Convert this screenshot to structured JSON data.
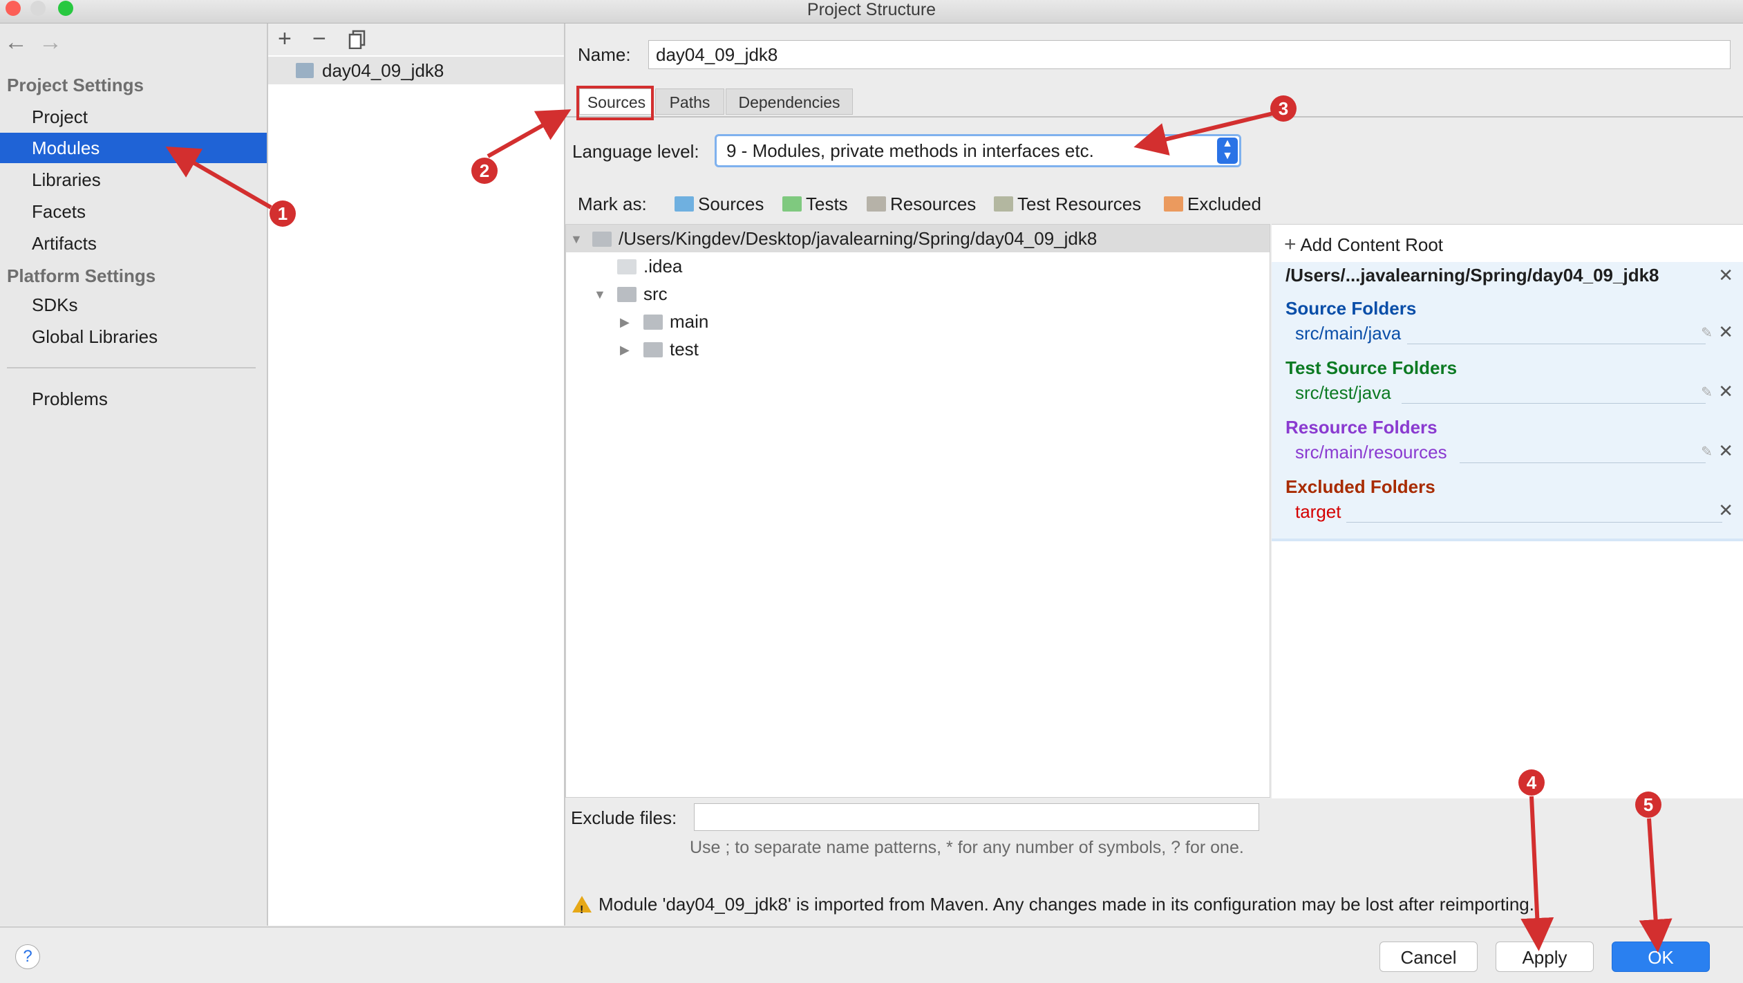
{
  "window": {
    "title": "Project Structure"
  },
  "colors": {
    "accent": "#1f63d6",
    "annotation": "#d32f2f",
    "source": "#0a4ea8",
    "test": "#0c7a23",
    "resource": "#8a3ad0",
    "excluded": "#a82b00",
    "excluded_path": "#d40000"
  },
  "nav": {
    "back_icon": "arrow-left-icon",
    "forward_icon": "arrow-right-icon"
  },
  "sidebar": {
    "project_settings_header": "Project Settings",
    "project_items": [
      "Project",
      "Modules",
      "Libraries",
      "Facets",
      "Artifacts"
    ],
    "selected": "Modules",
    "platform_settings_header": "Platform Settings",
    "platform_items": [
      "SDKs",
      "Global Libraries"
    ],
    "problems": "Problems"
  },
  "module_list": {
    "toolbar": {
      "add": "+",
      "remove": "−"
    },
    "modules": [
      "day04_09_jdk8"
    ]
  },
  "editor": {
    "name_label": "Name:",
    "name_value": "day04_09_jdk8",
    "tabs": [
      "Sources",
      "Paths",
      "Dependencies"
    ],
    "active_tab": "Sources",
    "language_level_label": "Language level:",
    "language_level_value": "9 - Modules, private methods in interfaces etc.",
    "mark_as_label": "Mark as:",
    "mark_as": [
      "Sources",
      "Tests",
      "Resources",
      "Test Resources",
      "Excluded"
    ],
    "tree": {
      "root": "/Users/Kingdev/Desktop/javalearning/Spring/day04_09_jdk8",
      "idea": ".idea",
      "src": "src",
      "main": "main",
      "test": "test"
    },
    "content_root": {
      "add_label": "Add Content Root",
      "path": "/Users/...javalearning/Spring/day04_09_jdk8",
      "source_folders_header": "Source Folders",
      "source_folders": [
        "src/main/java"
      ],
      "test_source_folders_header": "Test Source Folders",
      "test_source_folders": [
        "src/test/java"
      ],
      "resource_folders_header": "Resource Folders",
      "resource_folders": [
        "src/main/resources"
      ],
      "excluded_folders_header": "Excluded Folders",
      "excluded_folders": [
        "target"
      ]
    },
    "exclude_files_label": "Exclude files:",
    "exclude_files_value": "",
    "exclude_hint": "Use ; to separate name patterns, * for any number of symbols, ? for one.",
    "warning": "Module 'day04_09_jdk8' is imported from Maven. Any changes made in its configuration may be lost after reimporting."
  },
  "buttons": {
    "help": "?",
    "cancel": "Cancel",
    "apply": "Apply",
    "ok": "OK"
  },
  "annotations": [
    "1",
    "2",
    "3",
    "4",
    "5"
  ]
}
